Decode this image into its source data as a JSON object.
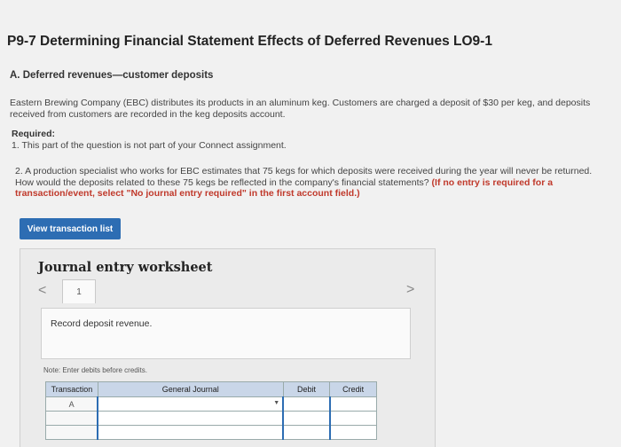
{
  "header": {
    "title": "P9-7 Determining Financial Statement Effects of Deferred Revenues LO9-1"
  },
  "part_a": {
    "heading": "A. Deferred revenues—customer deposits",
    "paragraph": "Eastern Brewing Company (EBC) distributes its products in an aluminum keg. Customers are charged a deposit of $30 per keg, and deposits received from customers are recorded in the keg deposits account."
  },
  "required": {
    "label": "Required:",
    "item1": "1. This part of the question is not part of your Connect assignment.",
    "item2_text": "2. A production specialist who works for EBC estimates that 75 kegs for which deposits were received during the year will never be returned. How would the deposits related to these 75 kegs be reflected in the company's financial statements?",
    "item2_hint": "(If no entry is required for a transaction/event, select \"No journal entry required\" in the first account field.)"
  },
  "buttons": {
    "view_transactions": "View transaction list"
  },
  "worksheet": {
    "title": "Journal entry worksheet",
    "nav_prev": "<",
    "nav_next": ">",
    "page": "1",
    "description": "Record deposit revenue.",
    "note": "Note: Enter debits before credits.",
    "columns": [
      "Transaction",
      "General Journal",
      "Debit",
      "Credit"
    ],
    "rows": [
      {
        "transaction": "A",
        "account": "",
        "debit": "",
        "credit": ""
      },
      {
        "transaction": "",
        "account": "",
        "debit": "",
        "credit": ""
      },
      {
        "transaction": "",
        "account": "",
        "debit": "",
        "credit": ""
      }
    ]
  }
}
